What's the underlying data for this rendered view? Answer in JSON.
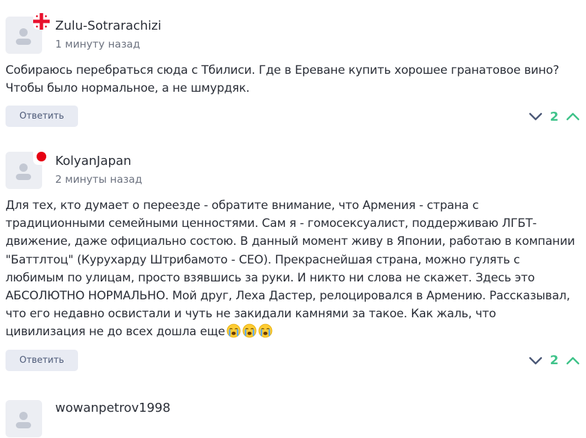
{
  "comments": [
    {
      "username": "Zulu-Sotrarachizi",
      "time": "1 минуту назад",
      "flag": "georgia-flag",
      "text": "Собираюсь перебраться сюда с Тбилиси. Где в Ереване купить хорошее гранатовое вино? Чтобы было нормальное, а не шмурдяк.",
      "reply_label": "Ответить",
      "score": "2"
    },
    {
      "username": "KolyanJapan",
      "time": "2 минуты назад",
      "flag": "japan-flag",
      "text": "Для тех, кто думает о переезде - обратите внимание, что Армения - страна с традиционными семейными ценностями. Сам я - гомосексуалист, поддерживаю ЛГБТ-движение, даже официально состою. В данный момент живу в Японии, работаю в компании \"Баттлтоц\" (Курухарду Штрибамото - CEO). Прекраснейшая страна, можно гулять с любимым по улицам, просто взявшись за руки. И никто ни слова не скажет. Здесь это АБСОЛЮТНО НОРМАЛЬНО. Мой друг, Леха Дастер, релоцировался в Армению. Рассказывал, что его недавно освистали и чуть не закидали камнями за такое. Как жаль, что цивилизация не до всех дошла еще",
      "emojis": [
        "crying-face-icon",
        "crying-face-icon",
        "crying-face-icon"
      ],
      "reply_label": "Ответить",
      "score": "2"
    },
    {
      "username": "wowanpetrov1998"
    }
  ],
  "colors": {
    "score": "#3fc38a",
    "reply_bg": "#e8ebf3",
    "text": "#2b2f38",
    "muted": "#6d7380"
  }
}
